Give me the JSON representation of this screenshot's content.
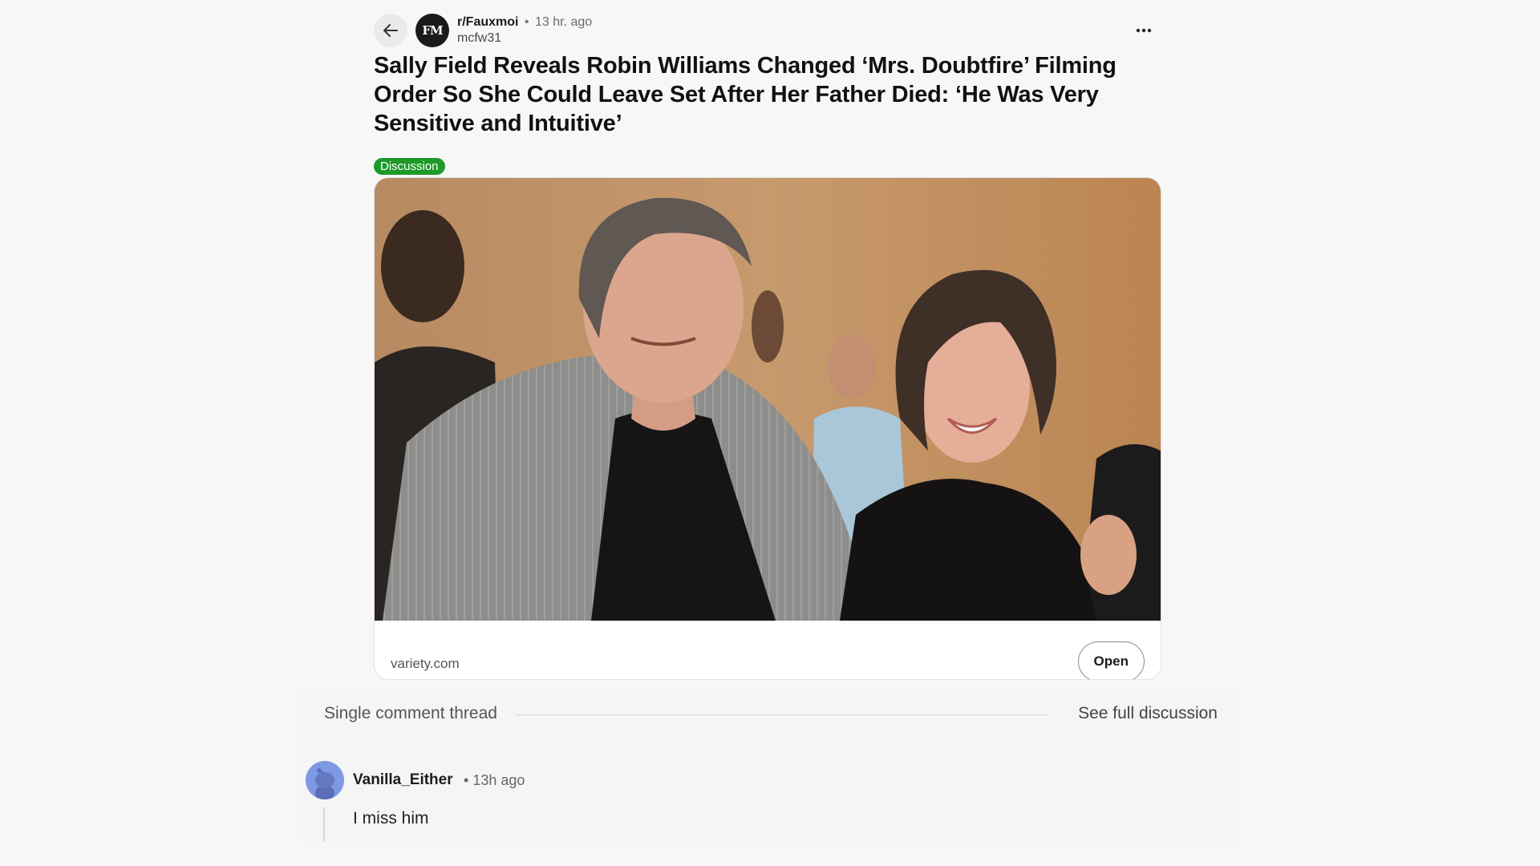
{
  "post": {
    "subreddit": "r/Fauxmoi",
    "subreddit_avatar_text": "FM",
    "separator": "•",
    "time": "13 hr. ago",
    "author": "mcfw31",
    "title": "Sally Field Reveals Robin Williams Changed ‘Mrs. Doubtfire’ Filming Order So She Could Leave Set After Her Father Died: ‘He Was Very Sensitive and Intuitive’",
    "flair": "Discussion",
    "flair_color": "#1d9a2a",
    "link_domain": "variety.com",
    "open_label": "Open",
    "icons": {
      "back": "arrow-left-icon",
      "more": "ellipsis-horizontal-icon"
    }
  },
  "thread": {
    "label": "Single comment thread",
    "see_full": "See full discussion",
    "comment": {
      "username": "Vanilla_Either",
      "separator": "•",
      "time": "13h ago",
      "body": "I miss him",
      "avatar_icon": "snoo-avatar-icon"
    }
  }
}
